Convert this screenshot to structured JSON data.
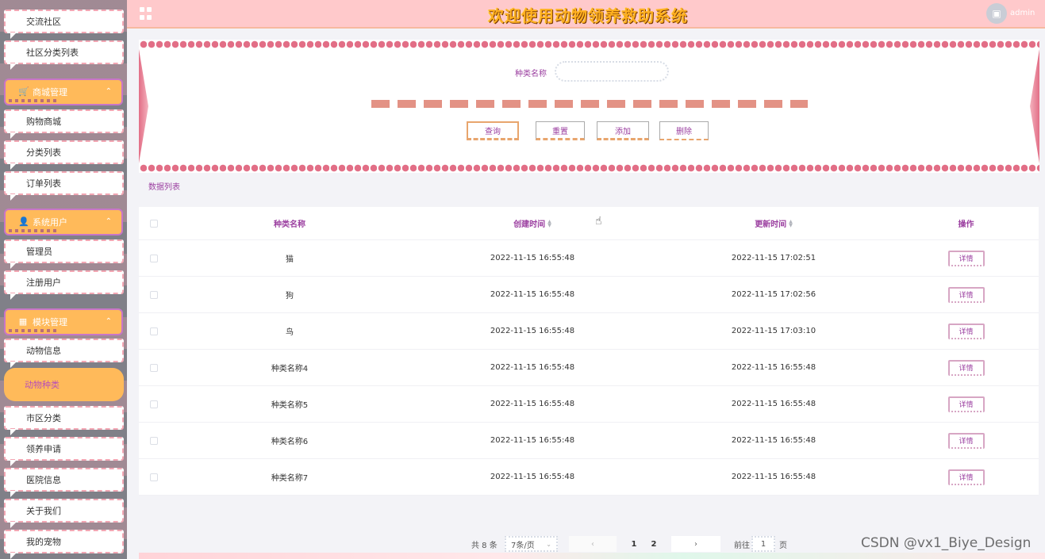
{
  "header": {
    "title": "欢迎使用动物领养救助系统",
    "user": "admin",
    "avatar_icon": "image-icon"
  },
  "sidebar": {
    "items_top": [
      "交流社区",
      "社区分类列表"
    ],
    "group_shop": "商城管理",
    "items_shop": [
      "购物商城",
      "分类列表",
      "订单列表"
    ],
    "group_user": "系统用户",
    "items_user": [
      "管理员",
      "注册用户"
    ],
    "group_module": "模块管理",
    "items_module": [
      "动物信息",
      "动物种类",
      "市区分类",
      "领养申请",
      "医院信息",
      "关于我们",
      "我的宠物"
    ],
    "active": "动物种类"
  },
  "search": {
    "label": "种类名称",
    "placeholder": "",
    "buttons": {
      "query": "查询",
      "reset": "重置",
      "add": "添加",
      "delete": "删除"
    }
  },
  "list_caption": "数据列表",
  "table": {
    "headers": {
      "name": "种类名称",
      "created": "创建时间",
      "updated": "更新时间",
      "ops": "操作"
    },
    "detail_label": "详情",
    "rows": [
      {
        "name": "猫",
        "created": "2022-11-15 16:55:48",
        "updated": "2022-11-15 17:02:51"
      },
      {
        "name": "狗",
        "created": "2022-11-15 16:55:48",
        "updated": "2022-11-15 17:02:56"
      },
      {
        "name": "鸟",
        "created": "2022-11-15 16:55:48",
        "updated": "2022-11-15 17:03:10"
      },
      {
        "name": "种类名称4",
        "created": "2022-11-15 16:55:48",
        "updated": "2022-11-15 16:55:48"
      },
      {
        "name": "种类名称5",
        "created": "2022-11-15 16:55:48",
        "updated": "2022-11-15 16:55:48"
      },
      {
        "name": "种类名称6",
        "created": "2022-11-15 16:55:48",
        "updated": "2022-11-15 16:55:48"
      },
      {
        "name": "种类名称7",
        "created": "2022-11-15 16:55:48",
        "updated": "2022-11-15 16:55:48"
      }
    ]
  },
  "pagination": {
    "total": "共 8 条",
    "page_size": "7条/页",
    "pages": [
      "1",
      "2"
    ],
    "goto_label": "前往",
    "goto_value": "1",
    "goto_unit": "页"
  },
  "watermark": "CSDN @vx1_Biye_Design"
}
